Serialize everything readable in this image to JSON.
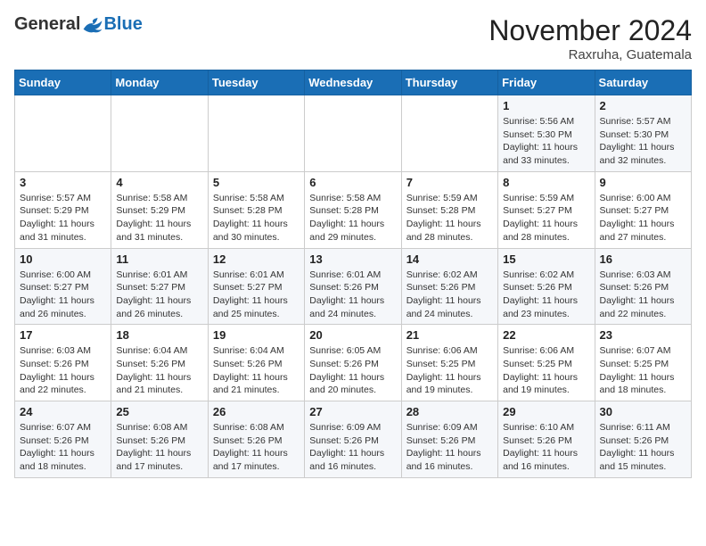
{
  "header": {
    "logo_general": "General",
    "logo_blue": "Blue",
    "month_title": "November 2024",
    "subtitle": "Raxruha, Guatemala"
  },
  "weekdays": [
    "Sunday",
    "Monday",
    "Tuesday",
    "Wednesday",
    "Thursday",
    "Friday",
    "Saturday"
  ],
  "weeks": [
    [
      {
        "day": "",
        "info": ""
      },
      {
        "day": "",
        "info": ""
      },
      {
        "day": "",
        "info": ""
      },
      {
        "day": "",
        "info": ""
      },
      {
        "day": "",
        "info": ""
      },
      {
        "day": "1",
        "info": "Sunrise: 5:56 AM\nSunset: 5:30 PM\nDaylight: 11 hours\nand 33 minutes."
      },
      {
        "day": "2",
        "info": "Sunrise: 5:57 AM\nSunset: 5:30 PM\nDaylight: 11 hours\nand 32 minutes."
      }
    ],
    [
      {
        "day": "3",
        "info": "Sunrise: 5:57 AM\nSunset: 5:29 PM\nDaylight: 11 hours\nand 31 minutes."
      },
      {
        "day": "4",
        "info": "Sunrise: 5:58 AM\nSunset: 5:29 PM\nDaylight: 11 hours\nand 31 minutes."
      },
      {
        "day": "5",
        "info": "Sunrise: 5:58 AM\nSunset: 5:28 PM\nDaylight: 11 hours\nand 30 minutes."
      },
      {
        "day": "6",
        "info": "Sunrise: 5:58 AM\nSunset: 5:28 PM\nDaylight: 11 hours\nand 29 minutes."
      },
      {
        "day": "7",
        "info": "Sunrise: 5:59 AM\nSunset: 5:28 PM\nDaylight: 11 hours\nand 28 minutes."
      },
      {
        "day": "8",
        "info": "Sunrise: 5:59 AM\nSunset: 5:27 PM\nDaylight: 11 hours\nand 28 minutes."
      },
      {
        "day": "9",
        "info": "Sunrise: 6:00 AM\nSunset: 5:27 PM\nDaylight: 11 hours\nand 27 minutes."
      }
    ],
    [
      {
        "day": "10",
        "info": "Sunrise: 6:00 AM\nSunset: 5:27 PM\nDaylight: 11 hours\nand 26 minutes."
      },
      {
        "day": "11",
        "info": "Sunrise: 6:01 AM\nSunset: 5:27 PM\nDaylight: 11 hours\nand 26 minutes."
      },
      {
        "day": "12",
        "info": "Sunrise: 6:01 AM\nSunset: 5:27 PM\nDaylight: 11 hours\nand 25 minutes."
      },
      {
        "day": "13",
        "info": "Sunrise: 6:01 AM\nSunset: 5:26 PM\nDaylight: 11 hours\nand 24 minutes."
      },
      {
        "day": "14",
        "info": "Sunrise: 6:02 AM\nSunset: 5:26 PM\nDaylight: 11 hours\nand 24 minutes."
      },
      {
        "day": "15",
        "info": "Sunrise: 6:02 AM\nSunset: 5:26 PM\nDaylight: 11 hours\nand 23 minutes."
      },
      {
        "day": "16",
        "info": "Sunrise: 6:03 AM\nSunset: 5:26 PM\nDaylight: 11 hours\nand 22 minutes."
      }
    ],
    [
      {
        "day": "17",
        "info": "Sunrise: 6:03 AM\nSunset: 5:26 PM\nDaylight: 11 hours\nand 22 minutes."
      },
      {
        "day": "18",
        "info": "Sunrise: 6:04 AM\nSunset: 5:26 PM\nDaylight: 11 hours\nand 21 minutes."
      },
      {
        "day": "19",
        "info": "Sunrise: 6:04 AM\nSunset: 5:26 PM\nDaylight: 11 hours\nand 21 minutes."
      },
      {
        "day": "20",
        "info": "Sunrise: 6:05 AM\nSunset: 5:26 PM\nDaylight: 11 hours\nand 20 minutes."
      },
      {
        "day": "21",
        "info": "Sunrise: 6:06 AM\nSunset: 5:25 PM\nDaylight: 11 hours\nand 19 minutes."
      },
      {
        "day": "22",
        "info": "Sunrise: 6:06 AM\nSunset: 5:25 PM\nDaylight: 11 hours\nand 19 minutes."
      },
      {
        "day": "23",
        "info": "Sunrise: 6:07 AM\nSunset: 5:25 PM\nDaylight: 11 hours\nand 18 minutes."
      }
    ],
    [
      {
        "day": "24",
        "info": "Sunrise: 6:07 AM\nSunset: 5:26 PM\nDaylight: 11 hours\nand 18 minutes."
      },
      {
        "day": "25",
        "info": "Sunrise: 6:08 AM\nSunset: 5:26 PM\nDaylight: 11 hours\nand 17 minutes."
      },
      {
        "day": "26",
        "info": "Sunrise: 6:08 AM\nSunset: 5:26 PM\nDaylight: 11 hours\nand 17 minutes."
      },
      {
        "day": "27",
        "info": "Sunrise: 6:09 AM\nSunset: 5:26 PM\nDaylight: 11 hours\nand 16 minutes."
      },
      {
        "day": "28",
        "info": "Sunrise: 6:09 AM\nSunset: 5:26 PM\nDaylight: 11 hours\nand 16 minutes."
      },
      {
        "day": "29",
        "info": "Sunrise: 6:10 AM\nSunset: 5:26 PM\nDaylight: 11 hours\nand 16 minutes."
      },
      {
        "day": "30",
        "info": "Sunrise: 6:11 AM\nSunset: 5:26 PM\nDaylight: 11 hours\nand 15 minutes."
      }
    ]
  ]
}
